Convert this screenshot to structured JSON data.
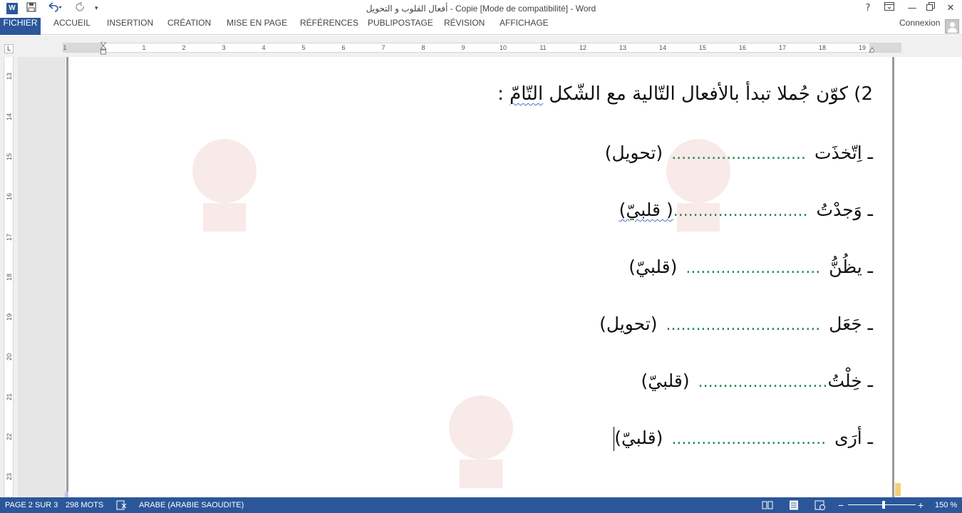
{
  "window": {
    "title": "أفعال القلوب و التحويل - Copie [Mode de compatibilité] - Word",
    "app_icon_letter": "W",
    "help": "?",
    "minimize": "—",
    "close": "✕"
  },
  "ribbon": {
    "tabs": [
      "FICHIER",
      "ACCUEIL",
      "INSERTION",
      "CRÉATION",
      "MISE EN PAGE",
      "RÉFÉRENCES",
      "PUBLIPOSTAGE",
      "RÉVISION",
      "AFFICHAGE"
    ],
    "account": "Connexion"
  },
  "ruler": {
    "tab_selector": "L",
    "h_numbers": [
      "1",
      "1",
      "2",
      "3",
      "4",
      "5",
      "6",
      "7",
      "8",
      "9",
      "10",
      "11",
      "12",
      "13",
      "14",
      "15",
      "16",
      "17",
      "18",
      "19"
    ],
    "v_numbers": [
      "13",
      "14",
      "15",
      "16",
      "17",
      "18",
      "19",
      "20",
      "21",
      "22",
      "23"
    ]
  },
  "document": {
    "heading_prefix": "2) كوّن جُملا تبدأ بالأفعال التّالية مع الشّكل ",
    "heading_underlined": "التّامّ",
    "heading_suffix": " :",
    "lines": [
      {
        "verb": "ـ اِتّخذَت",
        "dots": "...........................",
        "hint": "(تحويل)"
      },
      {
        "verb": "ـ وَجدْتُ",
        "dots": "...........................",
        "hint": "( قلبيّ)"
      },
      {
        "verb": "ـ يظُنُّ",
        "dots": "...........................",
        "hint": "(قلبيّ)"
      },
      {
        "verb": "ـ جَعَل",
        "dots": "...............................",
        "hint": "(تحويل)"
      },
      {
        "verb": "ـ خِلْتُ",
        "dots": "..........................",
        "hint": "(قلبيّ)"
      },
      {
        "verb": "ـ أرَى",
        "dots": "...............................",
        "hint": "(قلبيّ)"
      }
    ]
  },
  "statusbar": {
    "page": "PAGE 2 SUR 3",
    "words": "298 MOTS",
    "language": "ARABE (ARABIE SAOUDITE)",
    "zoom": "150 %",
    "zoom_level_percent": 150
  },
  "colors": {
    "brand": "#2b579a",
    "dots": "#1e8c4e",
    "squiggle": "#4a6fd1"
  }
}
